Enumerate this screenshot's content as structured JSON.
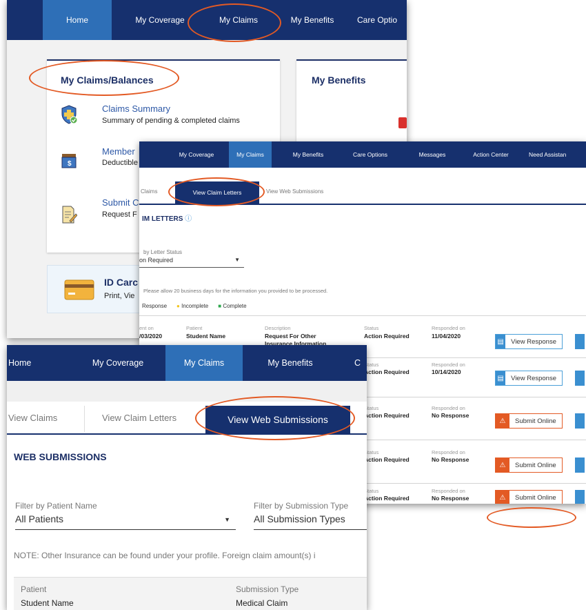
{
  "colors": {
    "nav": "#16306e",
    "nav_active": "#2e6fb7",
    "highlight_oval": "#e35a24",
    "link_blue": "#2d58a6",
    "response_blue": "#3a8fd0",
    "submit_orange": "#e35a24"
  },
  "panel1": {
    "nav": [
      "Home",
      "My Coverage",
      "My Claims",
      "My Benefits",
      "Care Optio"
    ],
    "claims_card": {
      "title": "My Claims/Balances",
      "items": [
        {
          "title": "Claims Summary",
          "desc": "Summary of pending & completed claims",
          "icon": "shield-check-icon"
        },
        {
          "title": "Member",
          "desc": "Deductible",
          "icon": "wallet-dollar-icon"
        },
        {
          "title": "Submit C",
          "desc": "Request F",
          "icon": "document-pencil-icon"
        }
      ]
    },
    "benefits_card": {
      "title": "My Benefits"
    },
    "id_card": {
      "title": "ID Carc",
      "desc": "Print, Vie",
      "icon": "credit-card-icon"
    }
  },
  "panel2": {
    "nav": [
      "My Coverage",
      "My Claims",
      "My Benefits",
      "Care Options",
      "Messages",
      "Action Center",
      "Need Assistan"
    ],
    "tabs": [
      "Claims",
      "View Claim Letters",
      "View Web Submissions"
    ],
    "heading": "IM LETTERS",
    "filter_label": "by Letter Status",
    "filter_value": "on Required",
    "note": "Please allow 20 business days for the information you provided to be processed.",
    "legend": [
      "Response",
      "Incomplete",
      "Complete"
    ],
    "row1": {
      "sent_label": "ent on",
      "sent_value": "/03/2020",
      "patient_label": "Patient",
      "patient_value": "Student Name",
      "desc_label": "Description",
      "desc_value": "Request For Other Insurance Information",
      "status_label": "Status",
      "status_value": "Action Required",
      "responded_label": "Responded on",
      "responded_value": "11/04/2020",
      "button": "View Response"
    },
    "rows": [
      {
        "status_label": "Status",
        "status_value": "Action Required",
        "responded_label": "Responded on",
        "responded_value": "10/14/2020",
        "button": "View Response"
      },
      {
        "status_label": "Status",
        "status_value": "Action Required",
        "responded_label": "Responded on",
        "responded_value": "No Response",
        "button": "Submit Online"
      },
      {
        "status_label": "Status",
        "status_value": "Action Required",
        "responded_label": "Responded on",
        "responded_value": "No Response",
        "button": "Submit Online"
      },
      {
        "status_label": "Status",
        "status_value": "Action Required",
        "responded_label": "Responded on",
        "responded_value": "No Response",
        "button": "Submit Online"
      }
    ]
  },
  "panel3": {
    "nav": [
      "Home",
      "My Coverage",
      "My Claims",
      "My Benefits",
      "C"
    ],
    "tabs": [
      "View Claims",
      "View Claim Letters",
      "View Web Submissions"
    ],
    "heading": "WEB SUBMISSIONS",
    "filter_patient_label": "Filter by Patient Name",
    "filter_patient_value": "All Patients",
    "filter_type_label": "Filter by Submission Type",
    "filter_type_value": "All Submission Types",
    "note": "NOTE: Other Insurance can be found under your profile. Foreign claim amount(s) i",
    "table_headers": [
      "Patient",
      "Submission Type"
    ],
    "table_row": [
      "Student Name",
      "Medical Claim"
    ]
  }
}
